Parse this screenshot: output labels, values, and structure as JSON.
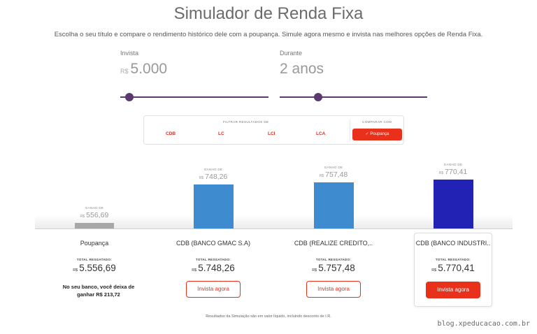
{
  "header": {
    "title": "Simulador de Renda Fixa",
    "subtitle": "Escolha o seu título e compare o rendimento histórico dele com a poupança. Simule agora mesmo e invista nas melhores opções de Renda Fixa."
  },
  "inputs": {
    "invest": {
      "label": "Invista",
      "currency": "R$",
      "value": "5.000"
    },
    "duration": {
      "label": "Durante",
      "value": "2 anos"
    }
  },
  "filters": {
    "title": "FILTRAR RESULTADOS DE",
    "options": [
      "CDB",
      "LC",
      "LCI",
      "LCA"
    ],
    "compare_title": "COMPARAR COM",
    "compare_check": "✓",
    "compare_value": "Poupança"
  },
  "gain_label": "GANHO DE",
  "currency": "R$",
  "total_label": "TOTAL RESGATADO:",
  "results": [
    {
      "name": "Poupança",
      "gain": "556,69",
      "gain_num": 556.69,
      "total": "5.556,69",
      "color": "#a8a8a8"
    },
    {
      "name": "CDB (BANCO GMAC S.A)",
      "gain": "748,26",
      "gain_num": 748.26,
      "total": "5.748,26",
      "color": "#3f8bd0",
      "button": "Invista agora"
    },
    {
      "name": "CDB (REALIZE CREDITO,..",
      "gain": "757,48",
      "gain_num": 757.48,
      "total": "5.757,48",
      "color": "#3f8bd0",
      "button": "Invista agora"
    },
    {
      "name": "CDB (BANCO INDUSTRI..",
      "gain": "770,41",
      "gain_num": 770.41,
      "total": "5.770,41",
      "color": "#2222b5",
      "button": "Invista agora"
    }
  ],
  "loss_message": "No seu banco, você deixa de ganhar R$ 213,72",
  "footnote": "Resultados da Simulação são em valor líquido, incluindo desconto de I.R.",
  "watermark": "blog.xpeducacao.com.br",
  "colors": {
    "accent": "#e8301a",
    "slider": "#5a3a6e"
  }
}
